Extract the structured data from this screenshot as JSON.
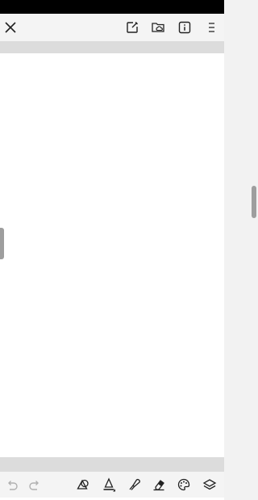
{
  "top_toolbar": {
    "icons": [
      "close-icon",
      "page-edit-icon",
      "folder-cloud-icon",
      "info-icon",
      "menu-icon"
    ]
  },
  "bottom_toolbar": {
    "icons": [
      "undo-icon",
      "redo-icon",
      "shapes-icon",
      "pen-icon",
      "highlighter-icon",
      "eraser-icon",
      "color-palette-icon",
      "layers-icon"
    ]
  },
  "colors": {
    "status_bar": "#000000",
    "toolbar": "#f4f4f4",
    "strip": "#dcdcdc",
    "canvas": "#ffffff",
    "handle": "#9e9e9e",
    "icon": "#222222",
    "icon_disabled": "#b0b0b0"
  }
}
